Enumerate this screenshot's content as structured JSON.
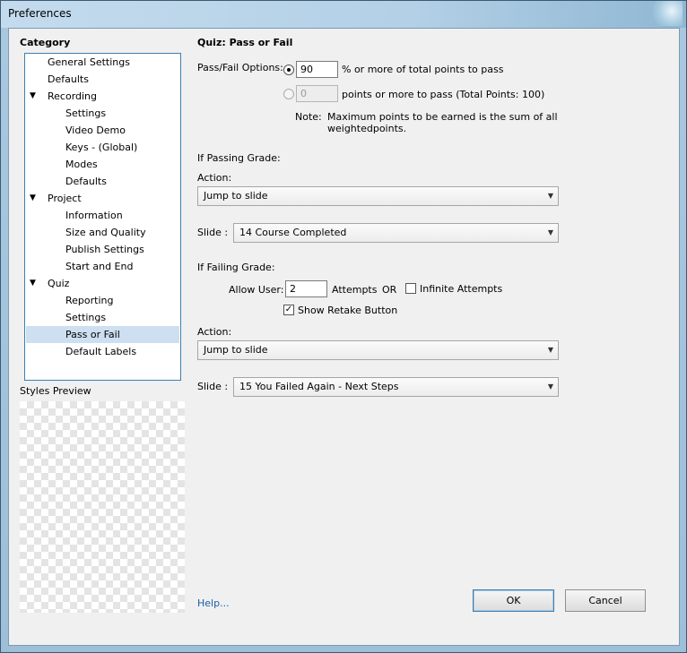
{
  "window": {
    "title": "Preferences"
  },
  "category": {
    "heading": "Category",
    "items": [
      {
        "label": "General Settings",
        "level": 0,
        "expander": false,
        "selected": false
      },
      {
        "label": "Defaults",
        "level": 0,
        "expander": false,
        "selected": false
      },
      {
        "label": "Recording",
        "level": 0,
        "expander": true,
        "selected": false
      },
      {
        "label": "Settings",
        "level": 1,
        "expander": false,
        "selected": false
      },
      {
        "label": "Video Demo",
        "level": 1,
        "expander": false,
        "selected": false
      },
      {
        "label": "Keys - (Global)",
        "level": 1,
        "expander": false,
        "selected": false
      },
      {
        "label": "Modes",
        "level": 1,
        "expander": false,
        "selected": false
      },
      {
        "label": "Defaults",
        "level": 1,
        "expander": false,
        "selected": false
      },
      {
        "label": "Project",
        "level": 0,
        "expander": true,
        "selected": false
      },
      {
        "label": "Information",
        "level": 1,
        "expander": false,
        "selected": false
      },
      {
        "label": "Size and Quality",
        "level": 1,
        "expander": false,
        "selected": false
      },
      {
        "label": "Publish Settings",
        "level": 1,
        "expander": false,
        "selected": false
      },
      {
        "label": "Start and End",
        "level": 1,
        "expander": false,
        "selected": false
      },
      {
        "label": "Quiz",
        "level": 0,
        "expander": true,
        "selected": false
      },
      {
        "label": "Reporting",
        "level": 1,
        "expander": false,
        "selected": false
      },
      {
        "label": "Settings",
        "level": 1,
        "expander": false,
        "selected": false
      },
      {
        "label": "Pass or Fail",
        "level": 1,
        "expander": true,
        "selected": true
      },
      {
        "label": "Default Labels",
        "level": 1,
        "expander": false,
        "selected": false
      }
    ],
    "expander_glyph": "▼"
  },
  "styles_preview": {
    "label": "Styles Preview"
  },
  "help": {
    "label": "Help..."
  },
  "panel": {
    "title": "Quiz: Pass or Fail",
    "pass_fail_label": "Pass/Fail Options:",
    "option_percent": {
      "value": "90",
      "suffix": "% or more of total points to pass",
      "checked": true
    },
    "option_points": {
      "value": "0",
      "suffix": "points or more to pass (Total Points: 100)",
      "checked": false
    },
    "note_label": "Note:",
    "note_line1": "Maximum points to be earned is the sum of all",
    "note_line2": "weightedpoints.",
    "passing": {
      "heading": "If Passing Grade:",
      "action_label": "Action:",
      "action_value": "Jump to slide",
      "slide_label": "Slide :",
      "slide_value": "14 Course Completed"
    },
    "failing": {
      "heading": "If Failing Grade:",
      "allow_user_label": "Allow User:",
      "attempts_value": "2",
      "attempts_label": "Attempts",
      "or_label": "OR",
      "infinite_label": "Infinite Attempts",
      "infinite_checked": false,
      "retake_label": "Show Retake Button",
      "retake_checked": true,
      "action_label": "Action:",
      "action_value": "Jump to slide",
      "slide_label": "Slide :",
      "slide_value": "15 You Failed Again - Next Steps"
    },
    "caret": "▼",
    "check_glyph": "✓"
  },
  "buttons": {
    "ok": "OK",
    "cancel": "Cancel"
  }
}
